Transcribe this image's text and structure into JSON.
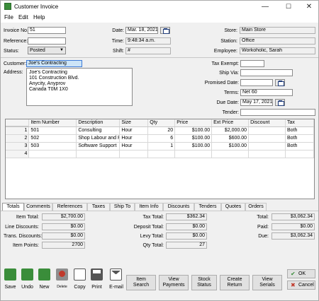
{
  "window": {
    "title": "Customer Invoice",
    "minimize": "—",
    "maximize": "☐",
    "close": "✕"
  },
  "menu": {
    "file": "File",
    "edit": "Edit",
    "help": "Help"
  },
  "header": {
    "invoice_no_label": "Invoice No.",
    "invoice_no": "51",
    "reference_label": "Reference:",
    "reference": "",
    "status_label": "Status:",
    "status": "Posted",
    "date_label": "Date:",
    "date": "Mar. 18, 2021",
    "time_label": "Time:",
    "time": "9:48:34 a.m.",
    "shift_label": "Shift:",
    "shift": "#",
    "store_label": "Store:",
    "store": "Main Store",
    "station_label": "Station:",
    "station": "Office",
    "employee_label": "Employee:",
    "employee": "Workoholic, Sarah"
  },
  "customer": {
    "customer_label": "Customer:",
    "customer": "Joe's Contracting",
    "address_label": "Address:",
    "address_lines": [
      "Joe's Contracting",
      "101 Construction Blvd.",
      "Anycity, Anyprov",
      "Canada  T0M 1X0"
    ],
    "tax_exempt_label": "Tax Exempt:",
    "tax_exempt": "",
    "ship_via_label": "Ship Via:",
    "ship_via": "",
    "promised_date_label": "Promised Date:",
    "promised_date": "",
    "terms_label": "Terms:",
    "terms": "Net 60",
    "due_date_label": "Due Date:",
    "due_date": "May 17, 2021",
    "tender_label": "Tender:",
    "tender": ""
  },
  "grid": {
    "columns": [
      "",
      "Item Number",
      "Description",
      "Size",
      "Qty",
      "Price",
      "Ext Price",
      "Discount",
      "Tax"
    ],
    "rows": [
      {
        "n": "1",
        "item": "501",
        "desc": "Consulting",
        "size": "Hour",
        "qty": "20",
        "price": "$100.00",
        "ext": "$2,000.00",
        "disc": "",
        "tax": "Both"
      },
      {
        "n": "2",
        "item": "502",
        "desc": "Shop Labour and Repair",
        "size": "Hour",
        "qty": "6",
        "price": "$100.00",
        "ext": "$600.00",
        "disc": "",
        "tax": "Both"
      },
      {
        "n": "3",
        "item": "503",
        "desc": "Software Support",
        "size": "Hour",
        "qty": "1",
        "price": "$100.00",
        "ext": "$100.00",
        "disc": "",
        "tax": "Both"
      },
      {
        "n": "4",
        "item": "",
        "desc": "",
        "size": "",
        "qty": "",
        "price": "",
        "ext": "",
        "disc": "",
        "tax": ""
      }
    ]
  },
  "tabs": [
    "Totals",
    "Comments",
    "References",
    "Taxes",
    "Ship To",
    "Item Info",
    "Discounts",
    "Tenders",
    "Quotes",
    "Orders"
  ],
  "totals": {
    "item_total_label": "Item Total:",
    "item_total": "$2,700.00",
    "line_discounts_label": "Line Discounts:",
    "line_discounts": "$0.00",
    "trans_discounts_label": "Trans. Discounts:",
    "trans_discounts": "$0.00",
    "item_points_label": "Item Points:",
    "item_points": "2700",
    "tax_total_label": "Tax Total:",
    "tax_total": "$362.34",
    "deposit_total_label": "Deposit Total:",
    "deposit_total": "$0.00",
    "levy_total_label": "Levy Total:",
    "levy_total": "$0.00",
    "qty_total_label": "Qty Total:",
    "qty_total": "27",
    "total_label": "Total:",
    "total": "$3,062.34",
    "paid_label": "Paid:",
    "paid": "$0.00",
    "due_label": "Due:",
    "due": "$3,062.34"
  },
  "toolbar": {
    "save": "Save",
    "undo": "Undo",
    "new": "New",
    "delete": "Delete",
    "copy": "Copy",
    "print": "Print",
    "email": "E-mail",
    "item_search": [
      "Item",
      "Search"
    ],
    "view_payments": [
      "View",
      "Payments"
    ],
    "stock_status": [
      "Stock",
      "Status"
    ],
    "create_return": [
      "Create",
      "Return"
    ],
    "view_serials": [
      "View",
      "Serials"
    ],
    "ok": "OK",
    "cancel": "Cancel"
  },
  "colors": {
    "accent_green": "#3a8d3a",
    "selection_blue": "#cce4f7",
    "delete_red": "#c0392b"
  }
}
